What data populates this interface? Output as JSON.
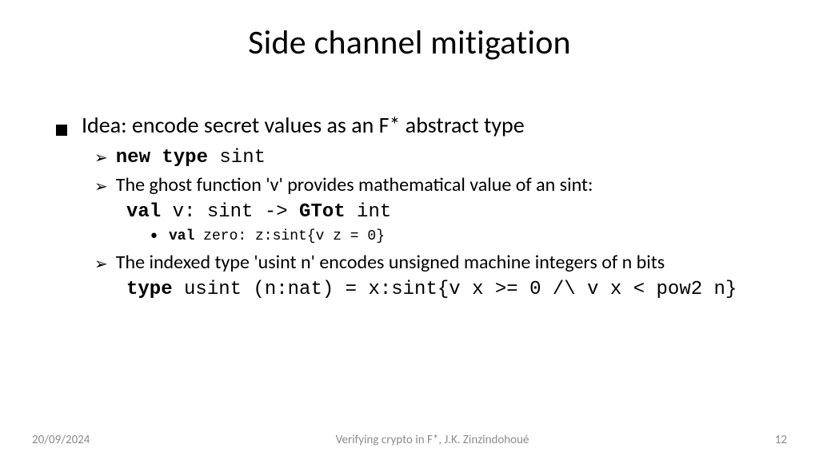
{
  "title": "Side channel mitigation",
  "bullet1": "Idea: encode secret values as an F* abstract type",
  "sub1": {
    "kw": "new type",
    "rest": " sint"
  },
  "sub2": "The ghost function 'v' provides mathematical value of an sint:",
  "code2": {
    "kw1": "val",
    "mid": " v: sint -> ",
    "kw2": "GTot",
    "end": " int"
  },
  "sub2b": {
    "kw": "val",
    "rest": " zero: z:sint{v z = 0}"
  },
  "sub3": "The indexed type 'usint n' encodes unsigned machine integers of n bits",
  "code3": {
    "kw": "type",
    "rest": " usint (n:nat) = x:sint{v x >= 0 /\\ v x < pow2 n}"
  },
  "footer": {
    "date": "20/09/2024",
    "center": "Verifying crypto  in F*, J.K. Zinzindohoué",
    "page": "12"
  }
}
